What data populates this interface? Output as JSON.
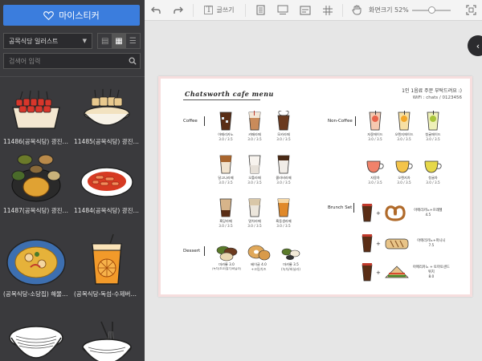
{
  "sidebar": {
    "mysticker_label": "마이스티커",
    "playlist_select": "공목식당 일러스트",
    "search_placeholder": "검색어 입력",
    "stickers": [
      {
        "caption": "11486(공목식당) 광진구 꼬"
      },
      {
        "caption": "11485(공목식당) 광진구 꼬"
      },
      {
        "caption": "11487(공목식당) 광진구 돈"
      },
      {
        "caption": "11484(공목식당) 광진구 꼬"
      },
      {
        "caption": "(공목식당-소당집) 해물카레"
      },
      {
        "caption": "(공목식당-독섬-수제버거집"
      },
      {
        "caption": ""
      },
      {
        "caption": ""
      }
    ]
  },
  "toolbar": {
    "text_label": "글쓰기",
    "zoom_label": "화면크기 52%",
    "zoom_value": 0.52
  },
  "menu": {
    "title": "Chatsworth cafe menu",
    "notice": "1인 1음료 주문 부탁드려요 :)",
    "wifi": "WiFi : chats / 0123456",
    "sections": {
      "coffee": "Coffee",
      "noncoffee": "Non-Coffee",
      "dessert": "Dessert",
      "brunch": "Brunch Set"
    },
    "coffee_items": [
      {
        "name": "아메리카노",
        "price": "3.0 / 3.5"
      },
      {
        "name": "카페라떼",
        "price": "3.0 / 3.5"
      },
      {
        "name": "모카라떼",
        "price": "3.0 / 3.5"
      },
      {
        "name": "달고나라떼",
        "price": "3.0 / 3.5"
      },
      {
        "name": "오틀라떼",
        "price": "3.0 / 3.5"
      },
      {
        "name": "콜라비라떼",
        "price": "3.0 / 3.5"
      },
      {
        "name": "흑당라떼",
        "price": "3.0 / 3.5"
      },
      {
        "name": "말차라떼",
        "price": "3.0 / 3.5"
      },
      {
        "name": "흑동생라떼",
        "price": "3.0 / 3.5"
      }
    ],
    "noncoffee_items": [
      {
        "name": "자몽에이드",
        "price": "3.0 / 3.5"
      },
      {
        "name": "오렌지에이드",
        "price": "3.0 / 3.5"
      },
      {
        "name": "청귤에이드",
        "price": "3.0 / 3.5"
      },
      {
        "name": "자몽차",
        "price": "3.0 / 3.5"
      },
      {
        "name": "오렌지차",
        "price": "3.0 / 3.5"
      },
      {
        "name": "청귤차",
        "price": "3.0 / 3.5"
      }
    ],
    "dessert_items": [
      {
        "name": "마카롱 3.0",
        "price": "(녹차/초코/딸기/바닐라)"
      },
      {
        "name": "베이글 4.0",
        "price": "+크림치즈"
      },
      {
        "name": "마카롱 3.5",
        "price": "(녹차/바닐라)"
      }
    ],
    "brunch_items": [
      {
        "text": "아메리카노+프레첼",
        "price": "4.5"
      },
      {
        "text": "아메리카노+파니니",
        "price": "7.5"
      },
      {
        "text": "아메리카노 + 토마토샌드위치",
        "price": "8.0"
      }
    ],
    "plus": "+"
  },
  "colors": {
    "accent": "#3b7ddd",
    "sidebar_bg": "#3a3a3d",
    "paper_border": "#f6dede"
  }
}
